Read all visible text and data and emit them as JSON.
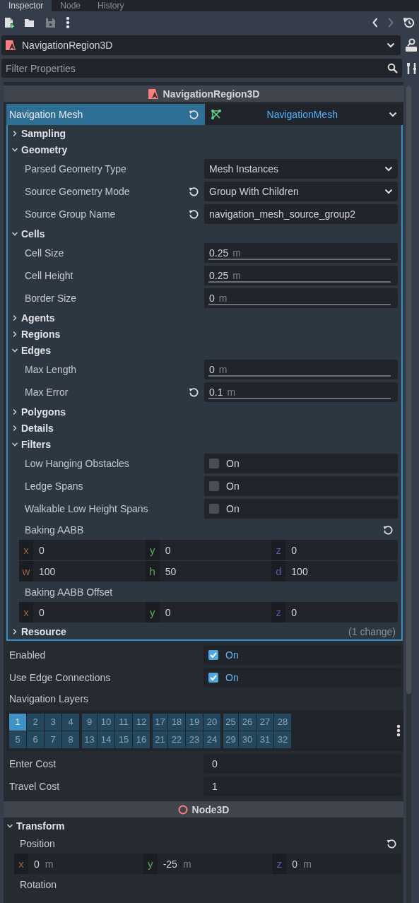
{
  "tabs": [
    {
      "label": "Inspector",
      "selected": true
    },
    {
      "label": "Node",
      "selected": false
    },
    {
      "label": "History",
      "selected": false
    }
  ],
  "object_selector": {
    "value": "NavigationRegion3D"
  },
  "filter": {
    "placeholder": "Filter Properties"
  },
  "properties": [
    {
      "kind": "category",
      "label": "NavigationRegion3D"
    },
    {
      "kind": "resource",
      "label": "Navigation Mesh",
      "value": "NavigationMesh",
      "revertable": true,
      "properties": [
        {
          "kind": "group",
          "label": "Sampling",
          "expanded": false
        },
        {
          "kind": "group",
          "label": "Geometry",
          "expanded": true,
          "children": [
            {
              "kind": "dropdown",
              "label": "Parsed Geometry Type",
              "value": "Mesh Instances",
              "revertable": false
            },
            {
              "kind": "dropdown",
              "label": "Source Geometry Mode",
              "value": "Group With Children",
              "revertable": true
            },
            {
              "kind": "text",
              "label": "Source Group Name",
              "value": "navigation_mesh_source_group2",
              "revertable": true
            }
          ]
        },
        {
          "kind": "group",
          "label": "Cells",
          "expanded": true,
          "children": [
            {
              "kind": "range",
              "label": "Cell Size",
              "value": "0.25",
              "unit": "m",
              "revertable": false
            },
            {
              "kind": "range",
              "label": "Cell Height",
              "value": "0.25",
              "unit": "m",
              "revertable": false
            },
            {
              "kind": "range",
              "label": "Border Size",
              "value": "0",
              "unit": "m",
              "revertable": false
            }
          ]
        },
        {
          "kind": "group",
          "label": "Agents",
          "expanded": false
        },
        {
          "kind": "group",
          "label": "Regions",
          "expanded": false
        },
        {
          "kind": "group",
          "label": "Edges",
          "expanded": true,
          "children": [
            {
              "kind": "range",
              "label": "Max Length",
              "value": "0",
              "unit": "m",
              "revertable": false
            },
            {
              "kind": "range",
              "label": "Max Error",
              "value": "0.1",
              "unit": "m",
              "revertable": true
            }
          ]
        },
        {
          "kind": "group",
          "label": "Polygons",
          "expanded": false
        },
        {
          "kind": "group",
          "label": "Details",
          "expanded": false
        },
        {
          "kind": "group",
          "label": "Filters",
          "expanded": true,
          "children": [
            {
              "kind": "check",
              "label": "Low Hanging Obstacles",
              "checked": false,
              "text": "On"
            },
            {
              "kind": "check",
              "label": "Ledge Spans",
              "checked": false,
              "text": "On"
            },
            {
              "kind": "check",
              "label": "Walkable Low Height Spans",
              "checked": false,
              "text": "On"
            },
            {
              "kind": "vector",
              "label": "Baking AABB",
              "revertable": true,
              "rows": [
                {
                  "fields": [
                    {
                      "axis": "x",
                      "value": "0"
                    },
                    {
                      "axis": "y",
                      "value": "0"
                    },
                    {
                      "axis": "z",
                      "value": "0"
                    }
                  ]
                },
                {
                  "fields": [
                    {
                      "axis": "w",
                      "value": "100"
                    },
                    {
                      "axis": "h",
                      "value": "50"
                    },
                    {
                      "axis": "d",
                      "value": "100"
                    }
                  ]
                }
              ]
            },
            {
              "kind": "vector",
              "label": "Baking AABB Offset",
              "revertable": false,
              "rows": [
                {
                  "fields": [
                    {
                      "axis": "x",
                      "value": "0"
                    },
                    {
                      "axis": "y",
                      "value": "0"
                    },
                    {
                      "axis": "z",
                      "value": "0"
                    }
                  ]
                }
              ]
            }
          ]
        },
        {
          "kind": "group",
          "label": "Resource",
          "expanded": false,
          "note": "(1 change)"
        }
      ]
    },
    {
      "kind": "check",
      "label": "Enabled",
      "checked": true,
      "text": "On"
    },
    {
      "kind": "check",
      "label": "Use Edge Connections",
      "checked": true,
      "text": "On"
    },
    {
      "kind": "layers",
      "label": "Navigation Layers",
      "layers": [
        {
          "label": "1",
          "selected": true
        },
        {
          "label": "2",
          "selected": false
        },
        {
          "label": "3",
          "selected": false
        },
        {
          "label": "4",
          "selected": false
        },
        {
          "label": "9",
          "selected": false
        },
        {
          "label": "10",
          "selected": false
        },
        {
          "label": "11",
          "selected": false
        },
        {
          "label": "12",
          "selected": false
        },
        {
          "label": "17",
          "selected": false
        },
        {
          "label": "18",
          "selected": false
        },
        {
          "label": "19",
          "selected": false
        },
        {
          "label": "20",
          "selected": false
        },
        {
          "label": "25",
          "selected": false
        },
        {
          "label": "26",
          "selected": false
        },
        {
          "label": "27",
          "selected": false
        },
        {
          "label": "28",
          "selected": false
        },
        {
          "label": "5",
          "selected": false
        },
        {
          "label": "6",
          "selected": false
        },
        {
          "label": "7",
          "selected": false
        },
        {
          "label": "8",
          "selected": false
        },
        {
          "label": "13",
          "selected": false
        },
        {
          "label": "14",
          "selected": false
        },
        {
          "label": "15",
          "selected": false
        },
        {
          "label": "16",
          "selected": false
        },
        {
          "label": "21",
          "selected": false
        },
        {
          "label": "22",
          "selected": false
        },
        {
          "label": "23",
          "selected": false
        },
        {
          "label": "24",
          "selected": false
        },
        {
          "label": "29",
          "selected": false
        },
        {
          "label": "30",
          "selected": false
        },
        {
          "label": "31",
          "selected": false
        },
        {
          "label": "32",
          "selected": false
        }
      ]
    },
    {
      "kind": "number",
      "label": "Enter Cost",
      "value": "0"
    },
    {
      "kind": "number",
      "label": "Travel Cost",
      "value": "1"
    },
    {
      "kind": "category",
      "label": "Node3D"
    },
    {
      "kind": "group",
      "label": "Transform",
      "expanded": true,
      "children": [
        {
          "kind": "vector",
          "label": "Position",
          "revertable": true,
          "rows": [
            {
              "fields": [
                {
                  "axis": "x",
                  "value": "0",
                  "unit": "m"
                },
                {
                  "axis": "y",
                  "value": "-25",
                  "unit": "m"
                },
                {
                  "axis": "z",
                  "value": "0",
                  "unit": "m"
                }
              ]
            }
          ]
        },
        {
          "kind": "label",
          "label": "Rotation"
        }
      ]
    }
  ]
}
